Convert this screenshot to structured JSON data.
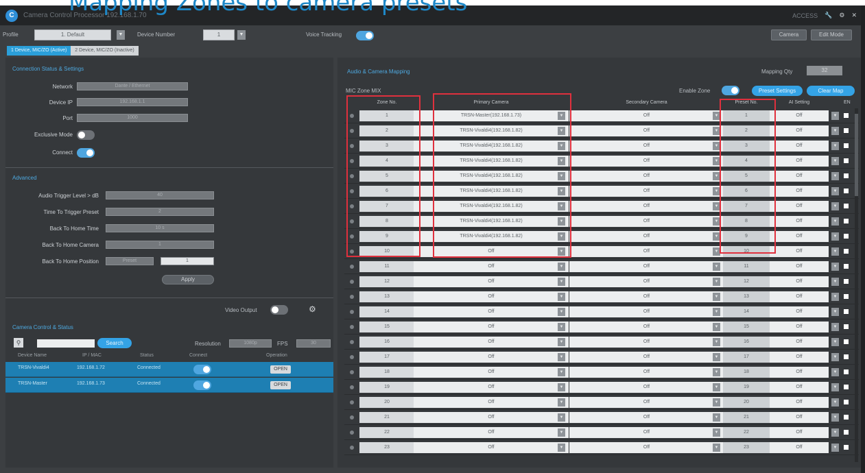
{
  "heading": "Mapping Zones to camera presets",
  "window": {
    "title": "Camera Control Processor 192.168.1.70",
    "status": "ACCESS",
    "user_icon": "wrench-icon",
    "settings_icon": "gear-icon"
  },
  "toolbar": {
    "profile_label": "Profile",
    "profile_value": "1. Default",
    "device_number_label": "Device Number",
    "device_number_value": "1",
    "voice_tracking_label": "Voice Tracking",
    "btn_1": "Camera",
    "btn_2": "Edit Mode"
  },
  "tabs": [
    "1 Device, MIC/ZO (Active)",
    "2 Device, MIC/ZO (Inactive)"
  ],
  "connection": {
    "title": "Connection Status & Settings",
    "network_label": "Network",
    "network_value": "Dante / Ethernet",
    "device_ip_label": "Device IP",
    "device_ip_value": "192.168.1.1",
    "port_label": "Port",
    "port_value": "1000",
    "exclusive_label": "Exclusive Mode",
    "connect_label": "Connect"
  },
  "advanced": {
    "title": "Advanced",
    "audio_trigger_label": "Audio Trigger Level > dB",
    "audio_trigger_value": "40",
    "time_to_trigger_label": "Time To Trigger Preset",
    "time_to_trigger_value": "2",
    "back_home_time_label": "Back To Home Time",
    "back_home_time_value": "10 s",
    "back_home_camera_label": "Back To Home Camera",
    "back_home_camera_value": "1",
    "back_home_position_label": "Back To Home Position",
    "back_home_position_value": "Preset",
    "back_home_position_value2": "1",
    "apply_label": "Apply"
  },
  "video": {
    "video_output_label": "Video Output",
    "settings_icon": "gear-icon",
    "section_title": "Camera Control & Status",
    "search_placeholder": "",
    "search_btn": "Search",
    "resolution_label": "Resolution",
    "resolution_value": "1080p",
    "fps_label": "FPS",
    "fps_value": "30",
    "columns": [
      "Device Name",
      "IP / MAC",
      "Status",
      "Connect",
      "Operation"
    ],
    "devices": [
      {
        "name": "TRSN-Vivaldi4",
        "ip": "192.168.1.72",
        "status": "Connected",
        "op": "OPEN"
      },
      {
        "name": "TRSN-Master",
        "ip": "192.168.1.73",
        "status": "Connected",
        "op": "OPEN"
      }
    ]
  },
  "mapping": {
    "title": "Audio & Camera Mapping",
    "mapping_qty_label": "Mapping Qty",
    "mapping_qty_value": "32",
    "mic_zone_label": "MIC Zone MIX",
    "enable_zone_label": "Enable Zone",
    "btn_a": "Preset Settings",
    "btn_b": "Clear Map",
    "columns": {
      "zone": "Zone No.",
      "primary": "Primary Camera",
      "secondary": "Secondary Camera",
      "preset": "Preset No.",
      "ai": "AI Setting",
      "en": "EN"
    },
    "rows": [
      {
        "zone": "1",
        "primary": "TRSN-Master(192.168.1.73)",
        "secondary": "Off",
        "preset": "1",
        "ai": "Off"
      },
      {
        "zone": "2",
        "primary": "TRSN-Vivaldi4(192.168.1.82)",
        "secondary": "Off",
        "preset": "2",
        "ai": "Off"
      },
      {
        "zone": "3",
        "primary": "TRSN-Vivaldi4(192.168.1.82)",
        "secondary": "Off",
        "preset": "3",
        "ai": "Off"
      },
      {
        "zone": "4",
        "primary": "TRSN-Vivaldi4(192.168.1.82)",
        "secondary": "Off",
        "preset": "4",
        "ai": "Off"
      },
      {
        "zone": "5",
        "primary": "TRSN-Vivaldi4(192.168.1.82)",
        "secondary": "Off",
        "preset": "5",
        "ai": "Off"
      },
      {
        "zone": "6",
        "primary": "TRSN-Vivaldi4(192.168.1.82)",
        "secondary": "Off",
        "preset": "6",
        "ai": "Off"
      },
      {
        "zone": "7",
        "primary": "TRSN-Vivaldi4(192.168.1.82)",
        "secondary": "Off",
        "preset": "7",
        "ai": "Off"
      },
      {
        "zone": "8",
        "primary": "TRSN-Vivaldi4(192.168.1.82)",
        "secondary": "Off",
        "preset": "8",
        "ai": "Off"
      },
      {
        "zone": "9",
        "primary": "TRSN-Vivaldi4(192.168.1.82)",
        "secondary": "Off",
        "preset": "9",
        "ai": "Off"
      },
      {
        "zone": "10",
        "primary": "Off",
        "secondary": "Off",
        "preset": "10",
        "ai": "Off"
      },
      {
        "zone": "11",
        "primary": "Off",
        "secondary": "Off",
        "preset": "11",
        "ai": "Off"
      },
      {
        "zone": "12",
        "primary": "Off",
        "secondary": "Off",
        "preset": "12",
        "ai": "Off"
      },
      {
        "zone": "13",
        "primary": "Off",
        "secondary": "Off",
        "preset": "13",
        "ai": "Off"
      },
      {
        "zone": "14",
        "primary": "Off",
        "secondary": "Off",
        "preset": "14",
        "ai": "Off"
      },
      {
        "zone": "15",
        "primary": "Off",
        "secondary": "Off",
        "preset": "15",
        "ai": "Off"
      },
      {
        "zone": "16",
        "primary": "Off",
        "secondary": "Off",
        "preset": "16",
        "ai": "Off"
      },
      {
        "zone": "17",
        "primary": "Off",
        "secondary": "Off",
        "preset": "17",
        "ai": "Off"
      },
      {
        "zone": "18",
        "primary": "Off",
        "secondary": "Off",
        "preset": "18",
        "ai": "Off"
      },
      {
        "zone": "19",
        "primary": "Off",
        "secondary": "Off",
        "preset": "19",
        "ai": "Off"
      },
      {
        "zone": "20",
        "primary": "Off",
        "secondary": "Off",
        "preset": "20",
        "ai": "Off"
      },
      {
        "zone": "21",
        "primary": "Off",
        "secondary": "Off",
        "preset": "21",
        "ai": "Off"
      },
      {
        "zone": "22",
        "primary": "Off",
        "secondary": "Off",
        "preset": "22",
        "ai": "Off"
      },
      {
        "zone": "23",
        "primary": "Off",
        "secondary": "Off",
        "preset": "23",
        "ai": "Off"
      }
    ]
  },
  "colors": {
    "accent": "#2b9fd9",
    "highlight": "#e0303d",
    "panel": "#35383b"
  }
}
